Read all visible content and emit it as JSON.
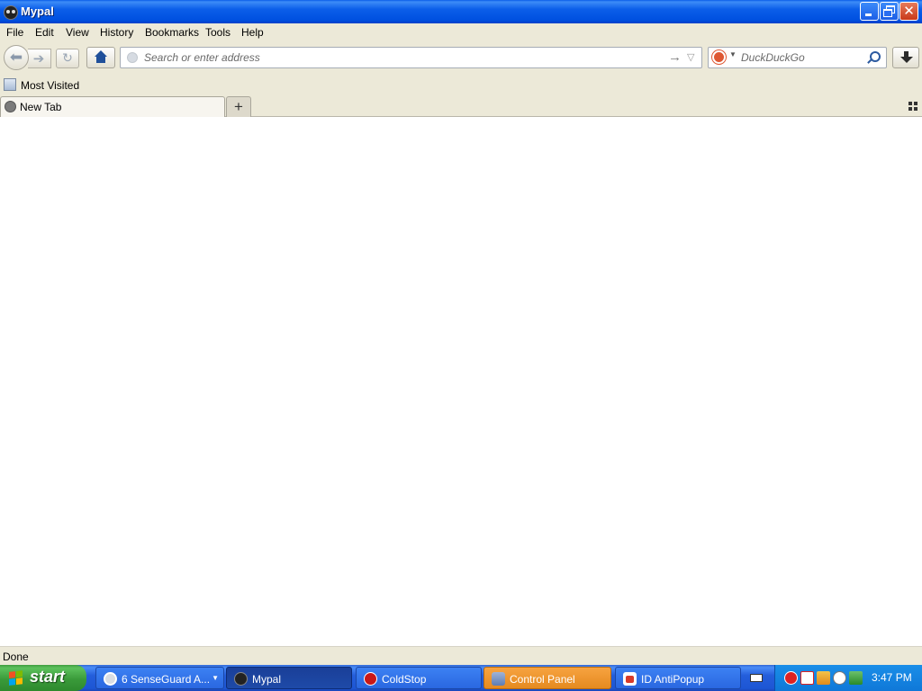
{
  "window": {
    "title": "Mypal",
    "app_icon": "mypal-icon"
  },
  "menu": {
    "items": [
      {
        "label": "File"
      },
      {
        "label": "Edit"
      },
      {
        "label": "View"
      },
      {
        "label": "History"
      },
      {
        "label": "Bookmarks"
      },
      {
        "label": "Tools"
      },
      {
        "label": "Help"
      }
    ]
  },
  "navbar": {
    "address_placeholder": "Search or enter address",
    "address_value": "",
    "search_placeholder": "DuckDuckGo",
    "search_engine_icon": "duckduckgo-icon"
  },
  "bookmarks": {
    "most_visited": "Most Visited"
  },
  "tabs": [
    {
      "label": "New Tab",
      "active": true
    }
  ],
  "status": {
    "text": "Done"
  },
  "taskbar": {
    "start_label": "start",
    "tasks": [
      {
        "label": "6 SenseGuard A..."
      },
      {
        "label": "Mypal",
        "active": true
      },
      {
        "label": "ColdStop"
      },
      {
        "label": "Control Panel",
        "highlighted": true
      },
      {
        "label": "ID AntiPopup"
      }
    ],
    "clock": "3:47 PM"
  },
  "colors": {
    "titlebar": "#0054e3",
    "taskbar": "#245edb",
    "start": "#3c9a3c",
    "chrome": "#ece9d8",
    "highlight_task": "#f0a030"
  }
}
